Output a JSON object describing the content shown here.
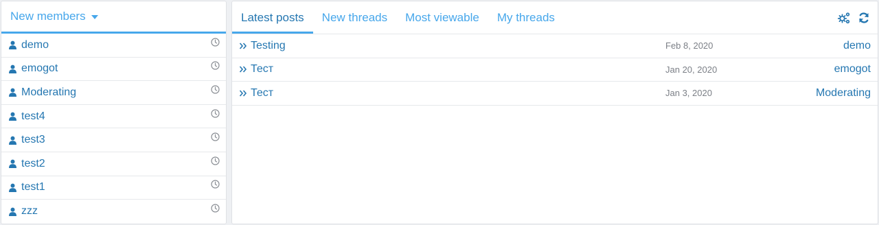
{
  "members_widget": {
    "title": "New members",
    "members": [
      {
        "name": "demo"
      },
      {
        "name": "emogot"
      },
      {
        "name": "Moderating"
      },
      {
        "name": "test4"
      },
      {
        "name": "test3"
      },
      {
        "name": "test2"
      },
      {
        "name": "test1"
      },
      {
        "name": "zzz"
      }
    ]
  },
  "threads_widget": {
    "tabs": [
      {
        "label": "Latest posts",
        "active": true
      },
      {
        "label": "New threads",
        "active": false
      },
      {
        "label": "Most viewable",
        "active": false
      },
      {
        "label": "My threads",
        "active": false
      }
    ],
    "tools": [
      "settings-gears-icon",
      "refresh-icon"
    ],
    "posts": [
      {
        "title": "Testing",
        "date": "Feb 8, 2020",
        "author": "demo"
      },
      {
        "title": "Тест",
        "date": "Jan 20, 2020",
        "author": "emogot"
      },
      {
        "title": "Тест",
        "date": "Jan 3, 2020",
        "author": "Moderating"
      }
    ]
  },
  "colors": {
    "accent": "#47a7eb",
    "link": "#2577b1",
    "muted": "#7b7f86",
    "border": "#e6e8eb",
    "background": "#eef0f3"
  }
}
